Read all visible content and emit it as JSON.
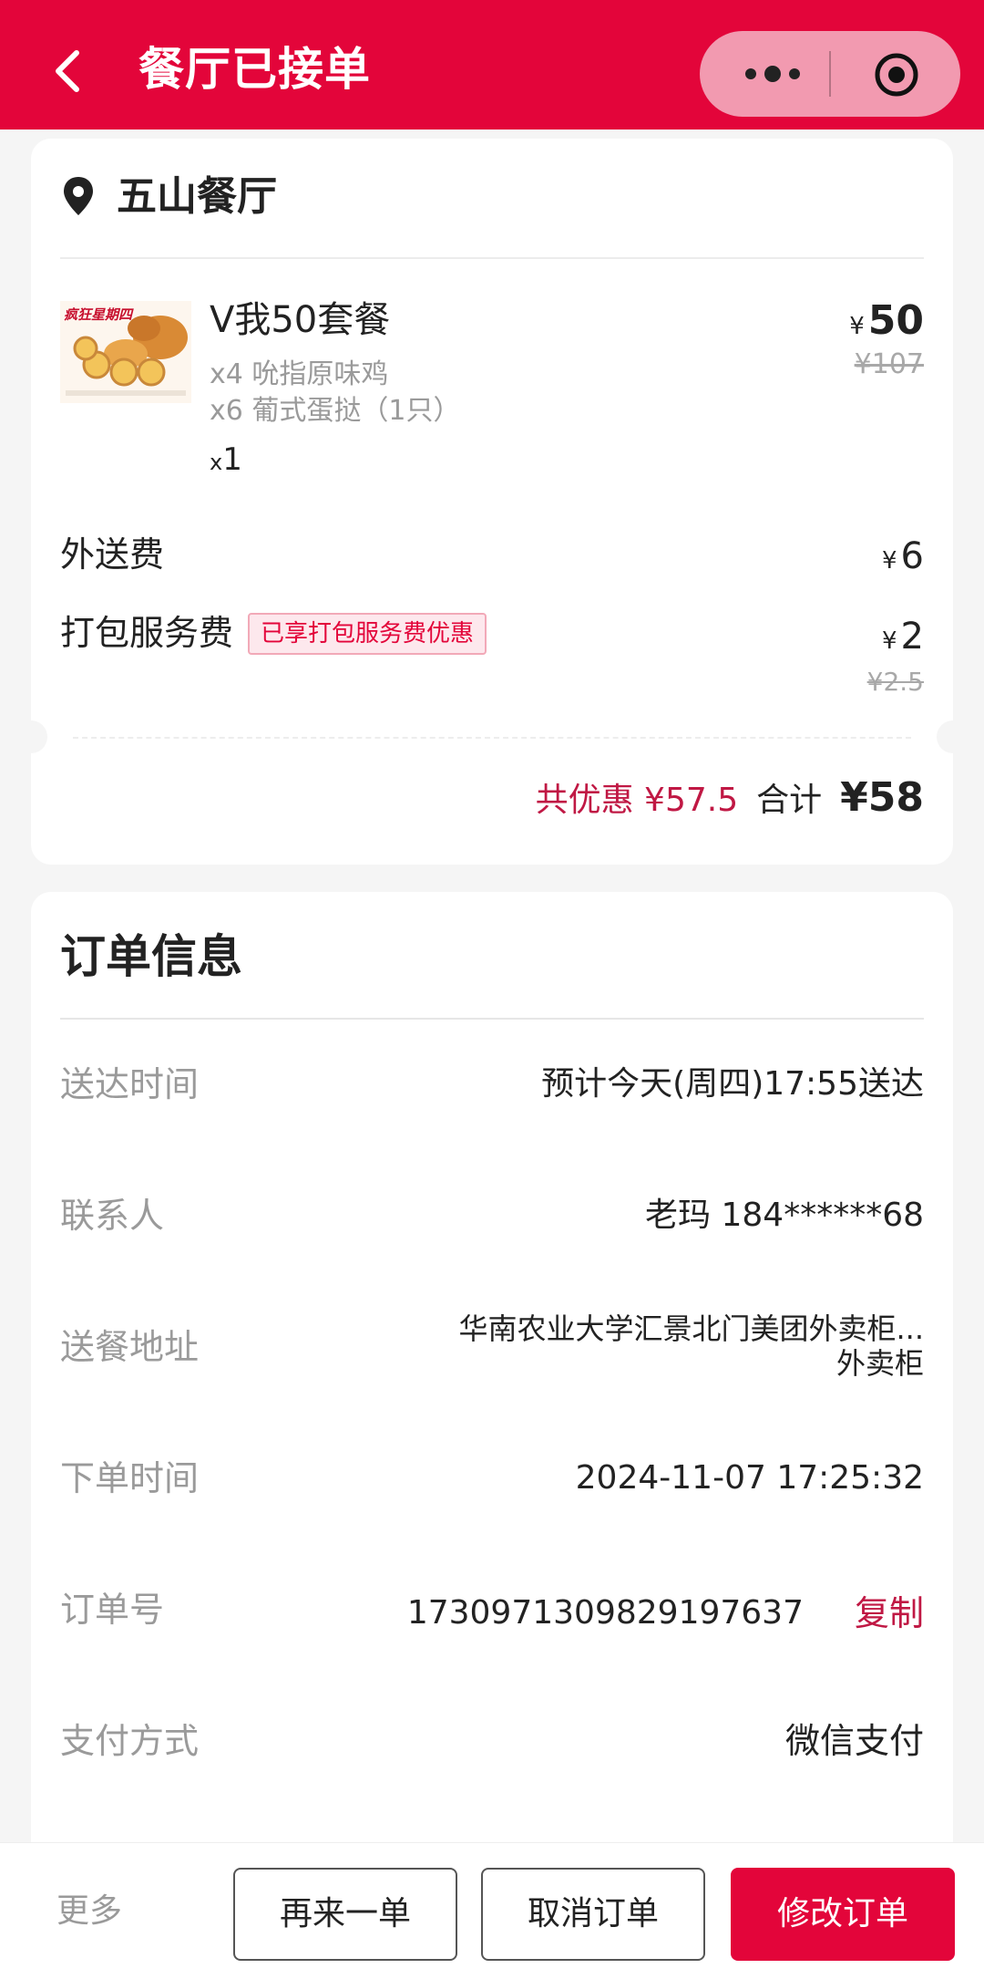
{
  "header": {
    "title": "餐厅已接单",
    "colors": {
      "bar": "#e3053a",
      "capsule": "#f29ab0"
    }
  },
  "store": {
    "name": "五山餐厅"
  },
  "item": {
    "name": "V我50套餐",
    "components": [
      "x4 吮指原味鸡",
      "x6 葡式蛋挞（1只）"
    ],
    "qty_prefix": "x",
    "qty": "1",
    "price_symbol": "¥",
    "price": "50",
    "original_price": "¥107",
    "image_caption": "疯狂星期四"
  },
  "fees": {
    "delivery_label": "外送费",
    "delivery_symbol": "¥",
    "delivery_value": "6",
    "packing_label": "打包服务费",
    "packing_tag": "已享打包服务费优惠",
    "packing_symbol": "¥",
    "packing_value": "2",
    "packing_original": "¥2.5"
  },
  "summary": {
    "discount": "共优惠 ¥57.5",
    "total_label": "合计",
    "total_value": "¥58"
  },
  "order_info": {
    "title": "订单信息",
    "rows": [
      {
        "label": "送达时间",
        "value": "预计今天(周四)17:55送达"
      },
      {
        "label": "联系人",
        "value": "老玛 184******68"
      },
      {
        "label": "送餐地址",
        "value": "华南农业大学汇景北门美团外卖柜...",
        "value2": "外卖柜"
      },
      {
        "label": "下单时间",
        "value": "2024-11-07 17:25:32"
      },
      {
        "label": "订单号",
        "value": "1730971309829197637",
        "action": "复制"
      },
      {
        "label": "支付方式",
        "value": "微信支付"
      }
    ]
  },
  "bottom_bar": {
    "more": "更多",
    "reorder": "再来一单",
    "cancel": "取消订单",
    "modify": "修改订单"
  },
  "icons": {
    "back": "back-arrow-icon",
    "more": "more-dots-icon",
    "close": "target-circle-icon",
    "location": "location-pin-icon"
  }
}
